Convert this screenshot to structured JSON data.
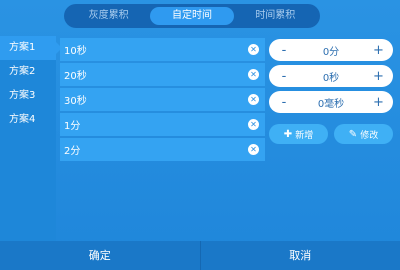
{
  "tabs": [
    "灰度累积",
    "自定时间",
    "时间累积"
  ],
  "active_tab": 1,
  "sidebar": {
    "items": [
      "方案1",
      "方案2",
      "方案3",
      "方案4"
    ],
    "active": 0
  },
  "time_list": [
    "10秒",
    "20秒",
    "30秒",
    "1分",
    "2分"
  ],
  "steppers": [
    {
      "minus": "-",
      "value": "0分",
      "plus": "+"
    },
    {
      "minus": "-",
      "value": "0秒",
      "plus": "+"
    },
    {
      "minus": "-",
      "value": "0毫秒",
      "plus": "+"
    }
  ],
  "actions": {
    "add": {
      "icon": "plus-icon",
      "label": "新增"
    },
    "edit": {
      "icon": "edit-icon",
      "label": "修改"
    }
  },
  "footer": {
    "confirm": "确定",
    "cancel": "取消"
  },
  "colors": {
    "background": "#2a93e3",
    "tab_bar": "#1565b3",
    "row": "#34a3f2",
    "footer": "#1a78c8"
  }
}
